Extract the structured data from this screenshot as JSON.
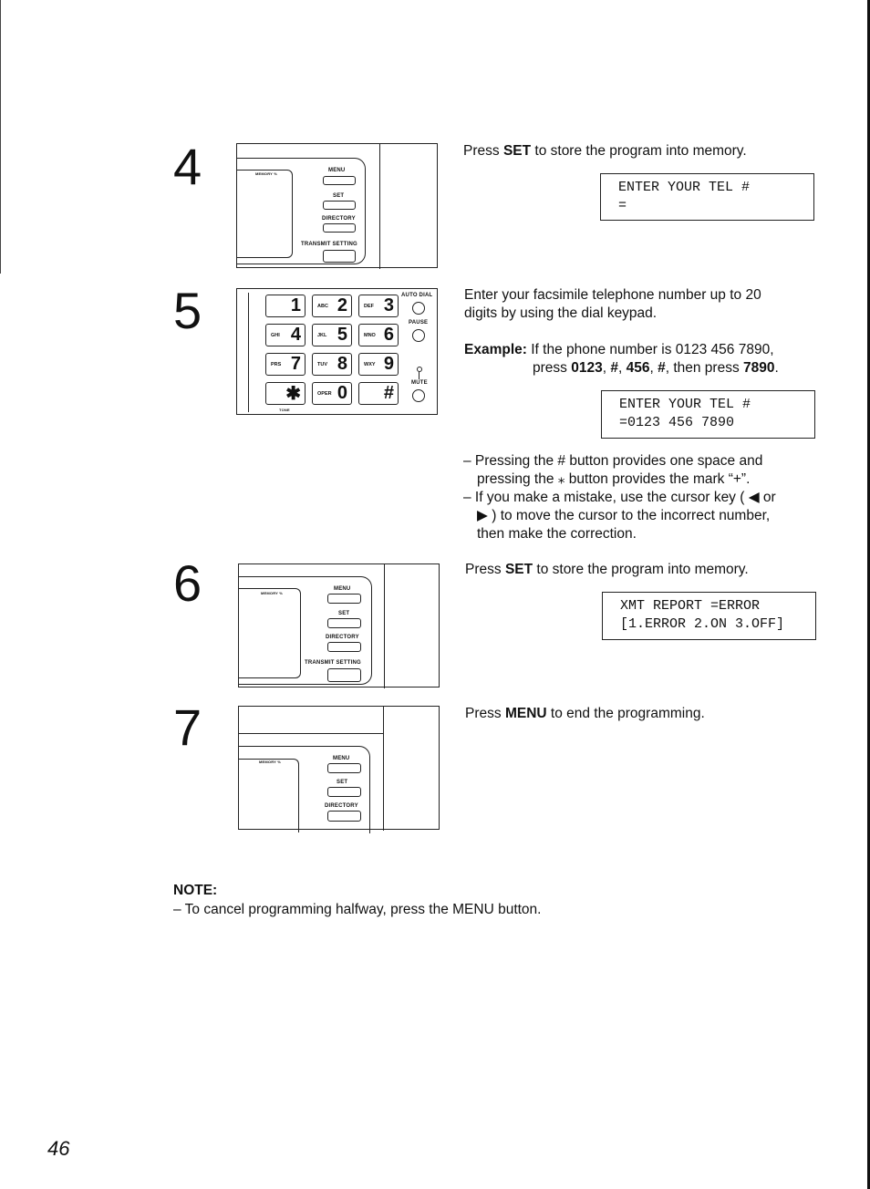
{
  "page_number": "46",
  "steps": [
    {
      "number": "4",
      "instruction_prefix": "Press ",
      "instruction_bold": "SET",
      "instruction_suffix": " to store the program into memory.",
      "display_lines": [
        "ENTER YOUR TEL #",
        "="
      ],
      "panel": {
        "memory_label": "MEMORY %",
        "buttons": [
          "MENU",
          "SET",
          "DIRECTORY",
          "TRANSMIT SETTING"
        ]
      }
    },
    {
      "number": "5",
      "instruction_line1": "Enter your facsimile telephone number up to 20",
      "instruction_line2": "digits by using the dial keypad.",
      "example_label": "Example:",
      "example_line1": " If the phone number is 0123 456 7890,",
      "example_line2_parts": [
        "press ",
        "0123",
        ", ",
        "#",
        ", ",
        "456",
        ", ",
        "#",
        ", then press ",
        "7890",
        "."
      ],
      "display_lines": [
        "ENTER YOUR TEL #",
        "=0123 456 7890"
      ],
      "notes": [
        {
          "line1": "– Pressing the # button provides one space and",
          "line2": "pressing the ⁎ button provides the mark “+”."
        },
        {
          "line1": "– If you make a mistake, use the cursor key ( ◀  or",
          "line2": "▶ ) to move the cursor to the incorrect number,",
          "line3": "then make the correction."
        }
      ],
      "keypad": {
        "keys": [
          {
            "sub": "",
            "main": "1"
          },
          {
            "sub": "ABC",
            "main": "2"
          },
          {
            "sub": "DEF",
            "main": "3"
          },
          {
            "sub": "GHI",
            "main": "4"
          },
          {
            "sub": "JKL",
            "main": "5"
          },
          {
            "sub": "MNO",
            "main": "6"
          },
          {
            "sub": "PRS",
            "main": "7"
          },
          {
            "sub": "TUV",
            "main": "8"
          },
          {
            "sub": "WXY",
            "main": "9"
          },
          {
            "sub": "",
            "main": "✱"
          },
          {
            "sub": "OPER",
            "main": "0"
          },
          {
            "sub": "",
            "main": "#"
          }
        ],
        "side_buttons": [
          "AUTO DIAL",
          "PAUSE",
          "MUTE"
        ],
        "tone_label": "TONE"
      }
    },
    {
      "number": "6",
      "instruction_prefix": "Press ",
      "instruction_bold": "SET",
      "instruction_suffix": " to store the program into memory.",
      "display_lines": [
        "XMT REPORT =ERROR",
        "[1.ERROR 2.ON 3.OFF]"
      ],
      "panel": {
        "memory_label": "MEMORY %",
        "buttons": [
          "MENU",
          "SET",
          "DIRECTORY",
          "TRANSMIT SETTING"
        ]
      }
    },
    {
      "number": "7",
      "instruction_prefix": "Press ",
      "instruction_bold": "MENU",
      "instruction_suffix": " to end the programming.",
      "panel": {
        "memory_label": "MEMORY %",
        "buttons": [
          "MENU",
          "SET",
          "DIRECTORY"
        ]
      }
    }
  ],
  "note": {
    "title": "NOTE:",
    "text": "– To cancel programming halfway, press the MENU button."
  }
}
